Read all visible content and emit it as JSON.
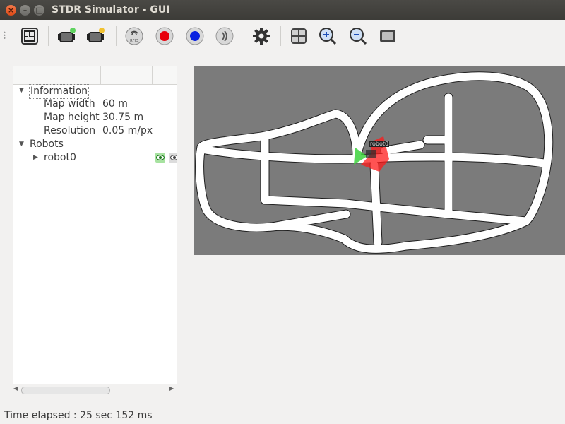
{
  "window": {
    "title": "STDR Simulator - GUI",
    "close_glyph": "×",
    "min_glyph": "–",
    "max_glyph": "□"
  },
  "toolbar": {
    "tools": [
      {
        "name": "load-map-icon"
      },
      {
        "name": "add-robot-icon"
      },
      {
        "name": "load-robot-icon"
      },
      {
        "name": "rfid-tag-icon"
      },
      {
        "name": "co2-source-icon",
        "color": "#e8000b"
      },
      {
        "name": "thermal-source-icon",
        "color": "#0a22e0"
      },
      {
        "name": "sound-source-icon"
      },
      {
        "name": "settings-gear-icon"
      },
      {
        "name": "grid-icon"
      },
      {
        "name": "zoom-in-icon"
      },
      {
        "name": "zoom-out-icon"
      },
      {
        "name": "adjust-zoom-icon"
      }
    ]
  },
  "tree": {
    "information_label": "Information",
    "properties": [
      {
        "key": "Map width",
        "value": "60 m"
      },
      {
        "key": "Map height",
        "value": "30.75 m"
      },
      {
        "key": "Resolution",
        "value": "0.05 m/px"
      }
    ],
    "robots_label": "Robots",
    "robots": [
      {
        "name": "robot0"
      }
    ]
  },
  "map": {
    "robot_label": "robot0",
    "background_color": "#7b7b7b",
    "corridor_color": "#ffffff",
    "laser_color": "#ff1a1a",
    "sonar_color": "#3cd23c"
  },
  "status": {
    "text": "Time elapsed : 25 sec 152 ms"
  }
}
